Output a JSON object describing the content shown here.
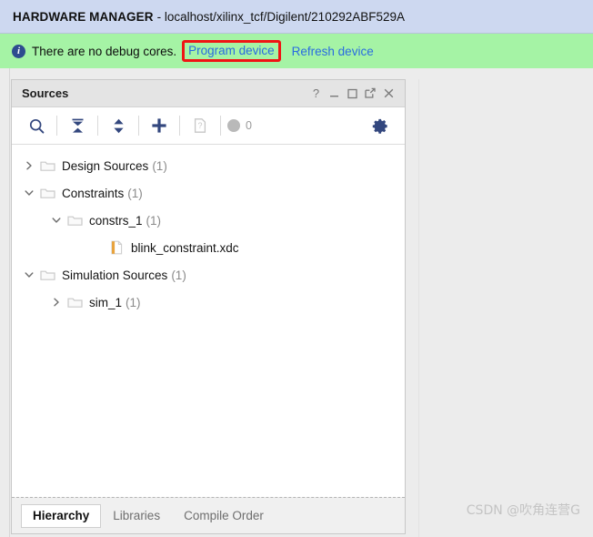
{
  "title_bar": {
    "app_label": "HARDWARE MANAGER",
    "target": "- localhost/xilinx_tcf/Digilent/210292ABF529A",
    "background": "#cdd8f0"
  },
  "info_bar": {
    "icon": "info-icon",
    "message": "There are no debug cores.",
    "program_device_link": "Program device",
    "refresh_device_link": "Refresh device",
    "background": "#a5f3a5",
    "link_color": "#2a6ce0",
    "highlight_color": "#f01414"
  },
  "sources_panel": {
    "title": "Sources",
    "header_buttons": [
      {
        "name": "help-icon",
        "glyph": "?"
      },
      {
        "name": "minimize-icon",
        "glyph": "_"
      },
      {
        "name": "maximize-icon",
        "glyph": "□"
      },
      {
        "name": "float-icon",
        "glyph": "↗"
      },
      {
        "name": "close-icon",
        "glyph": "✕"
      }
    ],
    "toolbar": {
      "search_label": "search-icon",
      "collapse_all_label": "collapse-all-icon",
      "expand_all_label": "expand-all-icon",
      "add_sources_label": "add-sources-icon",
      "report_label": "report-icon",
      "message_count": "0",
      "settings_label": "settings-gear-icon",
      "accent": "#33477e"
    },
    "tree": [
      {
        "label": "Design Sources",
        "count": "(1)",
        "icon": "folder-icon",
        "state": "collapsed",
        "depth": 0
      },
      {
        "label": "Constraints",
        "count": "(1)",
        "icon": "folder-icon",
        "state": "expanded",
        "depth": 0
      },
      {
        "label": "constrs_1",
        "count": "(1)",
        "icon": "folder-icon",
        "state": "expanded",
        "depth": 1
      },
      {
        "label": "blink_constraint.xdc",
        "count": "",
        "icon": "file-xdc-icon",
        "state": "leaf",
        "depth": 2
      },
      {
        "label": "Simulation Sources",
        "count": "(1)",
        "icon": "folder-icon",
        "state": "expanded",
        "depth": 0
      },
      {
        "label": "sim_1",
        "count": "(1)",
        "icon": "folder-icon",
        "state": "collapsed",
        "depth": 1
      }
    ],
    "tabs": [
      {
        "label": "Hierarchy",
        "active": true
      },
      {
        "label": "Libraries",
        "active": false
      },
      {
        "label": "Compile Order",
        "active": false
      }
    ]
  },
  "watermark": {
    "text": "CSDN @吹角连营G"
  }
}
